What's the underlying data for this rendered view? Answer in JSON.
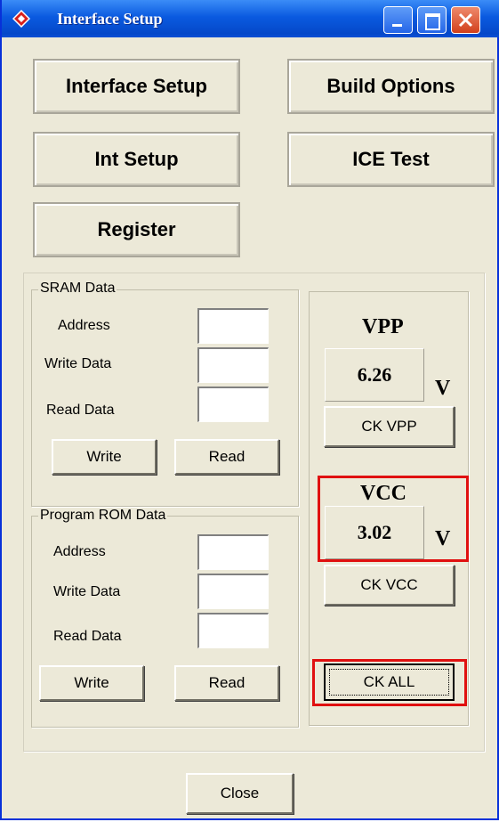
{
  "window": {
    "title": "Interface Setup",
    "icon": "diamond-app-icon"
  },
  "titlebar_buttons": [
    "minimize-icon",
    "maximize-icon",
    "close-icon"
  ],
  "top_buttons": {
    "interface_setup": "Interface Setup",
    "build_options": "Build Options",
    "int_setup": "Int Setup",
    "ice_test": "ICE Test",
    "register": "Register"
  },
  "sram": {
    "title": "SRAM Data",
    "address_label": "Address",
    "write_data_label": "Write Data",
    "read_data_label": "Read Data",
    "address": "",
    "write_data": "",
    "read_data": "",
    "write_button": "Write",
    "read_button": "Read"
  },
  "program_rom": {
    "title": "Program ROM Data",
    "address_label": "Address",
    "write_data_label": "Write Data",
    "read_data_label": "Read Data",
    "address": "",
    "write_data": "",
    "read_data": "",
    "write_button": "Write",
    "read_button": "Read"
  },
  "vpp": {
    "label": "VPP",
    "value": "6.26",
    "unit": "V",
    "button": "CK VPP"
  },
  "vcc": {
    "label": "VCC",
    "value": "3.02",
    "unit": "V",
    "button": "CK VCC"
  },
  "ck_all_button": "CK ALL",
  "close_button": "Close",
  "colors": {
    "highlight": "#e01010",
    "face": "#ece9d8",
    "titlebar": "#0a5ae0"
  }
}
